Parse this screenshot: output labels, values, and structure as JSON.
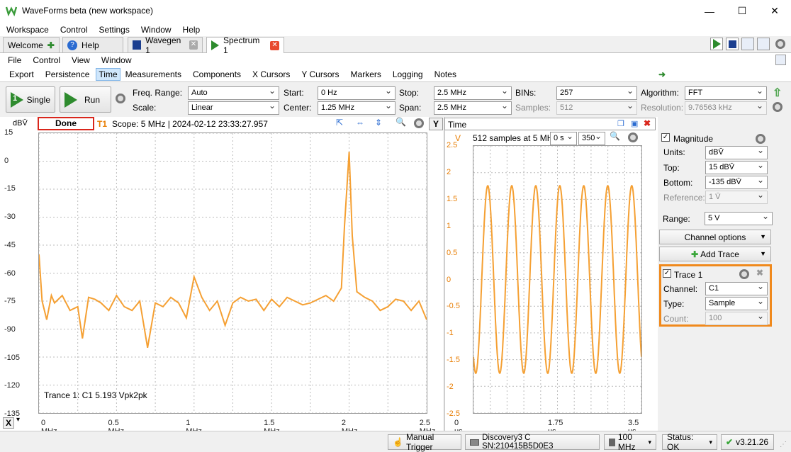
{
  "app": {
    "title": "WaveForms beta (new workspace)"
  },
  "window_controls": {
    "minimize": "—",
    "maximize": "☐",
    "close": "✕"
  },
  "menu": [
    "Workspace",
    "Control",
    "Settings",
    "Window",
    "Help"
  ],
  "tabs": [
    {
      "label": "Welcome"
    },
    {
      "label": "Help"
    },
    {
      "label": "Wavegen 1"
    },
    {
      "label": "Spectrum 1"
    }
  ],
  "submenu": [
    "File",
    "Control",
    "View",
    "Window"
  ],
  "subtabs": [
    "Export",
    "Persistence",
    "Time",
    "Measurements",
    "Components",
    "X Cursors",
    "Y Cursors",
    "Markers",
    "Logging",
    "Notes"
  ],
  "toolbar": {
    "single": "Single",
    "run": "Run",
    "freq_range_label": "Freq. Range:",
    "freq_range_value": "Auto",
    "scale_label": "Scale:",
    "scale_value": "Linear",
    "start_label": "Start:",
    "start_value": "0 Hz",
    "center_label": "Center:",
    "center_value": "1.25 MHz",
    "stop_label": "Stop:",
    "stop_value": "2.5 MHz",
    "span_label": "Span:",
    "span_value": "2.5 MHz",
    "bins_label": "BINs:",
    "bins_value": "257",
    "samples_label": "Samples:",
    "samples_value": "512",
    "algorithm_label": "Algorithm:",
    "algorithm_value": "FFT",
    "resolution_label": "Resolution:",
    "resolution_value": "9.76563 kHz"
  },
  "spectrum": {
    "unit": "dBV̄",
    "status": "Done",
    "trigger": "T1",
    "info": "Scope: 5 MHz | 2024-02-12 23:33:27.957",
    "y_axis_button": "Y",
    "x_axis_button": "X",
    "trace_label": "Trance 1: C1 5.193 Vpk2pk",
    "y_ticks": [
      "15",
      "0",
      "-15",
      "-30",
      "-45",
      "-60",
      "-75",
      "-90",
      "-105",
      "-120",
      "-135"
    ],
    "x_ticks": [
      "0 MHz",
      "0.5 MHz",
      "1 MHz",
      "1.5 MHz",
      "2 MHz",
      "2.5 MHz"
    ]
  },
  "time_view": {
    "title": "Time",
    "unit": "V",
    "info": "512 samples at 5 MHz",
    "offset_value": "0 s",
    "range_value": "350",
    "y_ticks": [
      "2.5",
      "2",
      "1.5",
      "1",
      "0.5",
      "0",
      "-0.5",
      "-1",
      "-1.5",
      "-2",
      "-2.5"
    ],
    "x_ticks": [
      "0 us",
      "1.75 us",
      "3.5 us"
    ]
  },
  "right_panel": {
    "magnitude_label": "Magnitude",
    "units_label": "Units:",
    "units_value": "dBV̄",
    "top_label": "Top:",
    "top_value": "15 dBV̄",
    "bottom_label": "Bottom:",
    "bottom_value": "-135 dBV̄",
    "reference_label": "Reference:",
    "reference_value": "1 V̄",
    "range_label": "Range:",
    "range_value": "5 V",
    "channel_options": "Channel options",
    "add_trace": "Add Trace",
    "trace_title": "Trace 1",
    "channel_label": "Channel:",
    "channel_value": "C1",
    "type_label": "Type:",
    "type_value": "Sample",
    "count_label": "Count:",
    "count_value": "100"
  },
  "status": {
    "manual_trigger": "Manual Trigger",
    "device": "Discovery3 C SN:210415B5D0E3",
    "rate": "100 MHz",
    "status": "Status: OK",
    "version": "v3.21.26"
  },
  "colors": {
    "trace": "#f5a033",
    "accent": "#e87e04",
    "status_border": "#d9261c",
    "play": "#2e8b2e"
  },
  "chart_data": [
    {
      "type": "line",
      "title": "",
      "xlabel": "",
      "ylabel": "dBV̄",
      "xlim": [
        0,
        2.5
      ],
      "ylim": [
        -135,
        15
      ],
      "series": [
        {
          "name": "Trance 1",
          "x": [
            0,
            0.02,
            0.05,
            0.08,
            0.1,
            0.15,
            0.2,
            0.25,
            0.28,
            0.32,
            0.36,
            0.4,
            0.45,
            0.5,
            0.55,
            0.6,
            0.65,
            0.7,
            0.75,
            0.8,
            0.85,
            0.9,
            0.95,
            1.0,
            1.05,
            1.1,
            1.15,
            1.2,
            1.25,
            1.3,
            1.35,
            1.4,
            1.45,
            1.5,
            1.55,
            1.6,
            1.65,
            1.7,
            1.75,
            1.8,
            1.85,
            1.9,
            1.95,
            1.97,
            2.0,
            2.02,
            2.05,
            2.1,
            2.15,
            2.2,
            2.25,
            2.3,
            2.35,
            2.4,
            2.45,
            2.5
          ],
          "y": [
            -50,
            -75,
            -85,
            -72,
            -76,
            -72,
            -80,
            -78,
            -95,
            -73,
            -74,
            -76,
            -80,
            -72,
            -78,
            -80,
            -75,
            -100,
            -76,
            -78,
            -73,
            -76,
            -84,
            -62,
            -73,
            -80,
            -75,
            -88,
            -76,
            -73,
            -75,
            -74,
            -80,
            -74,
            -78,
            -73,
            -75,
            -77,
            -76,
            -74,
            -72,
            -75,
            -68,
            -35,
            5,
            -40,
            -70,
            -73,
            -75,
            -80,
            -78,
            -74,
            -75,
            -80,
            -75,
            -85
          ]
        }
      ]
    },
    {
      "type": "line",
      "title": "",
      "xlabel": "",
      "ylabel": "V",
      "xlim": [
        0,
        3.5
      ],
      "ylim": [
        -2.5,
        2.5
      ],
      "series": [
        {
          "name": "C1",
          "x": [
            0,
            3.5
          ],
          "y": [
            -1.2,
            -1.2
          ],
          "frequency_mhz": 2.0,
          "amplitude_v": 2.6
        }
      ]
    }
  ]
}
